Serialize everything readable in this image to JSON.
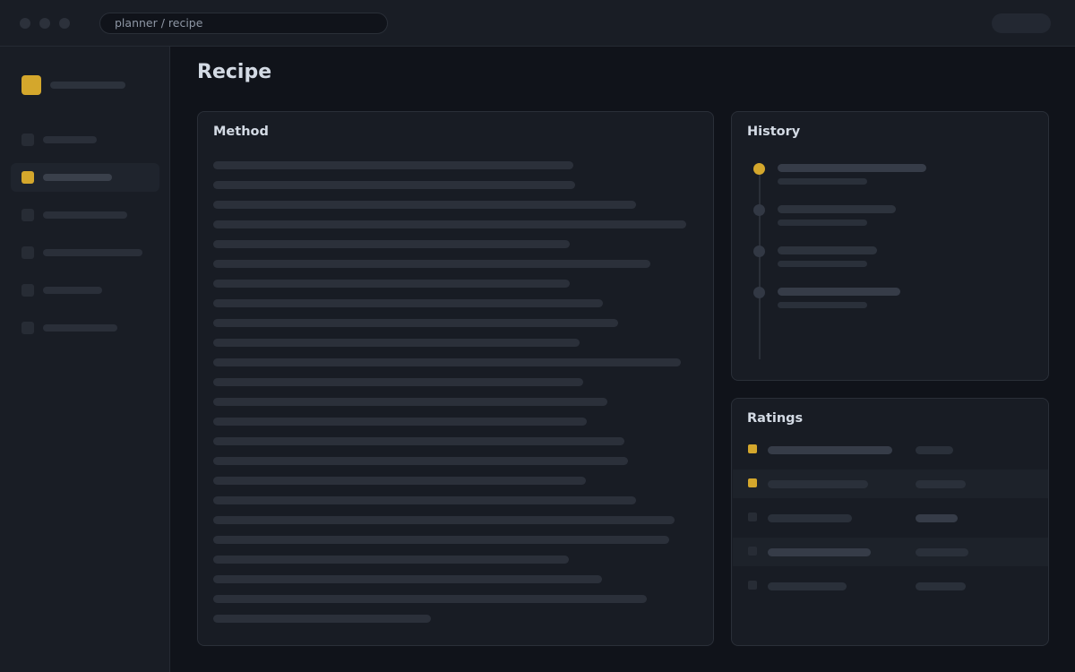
{
  "window": {
    "address": "planner / recipe",
    "accent": "#d4a72c"
  },
  "page": {
    "title": "Recipe"
  },
  "sidebar": {
    "nav_count": 6,
    "active_index": 1
  },
  "panels": {
    "method": {
      "title": "Method",
      "line_count": 24
    },
    "history": {
      "title": "History",
      "entry_count": 4,
      "active_index": 0
    },
    "ratings": {
      "title": "Ratings",
      "row_count": 5
    }
  }
}
